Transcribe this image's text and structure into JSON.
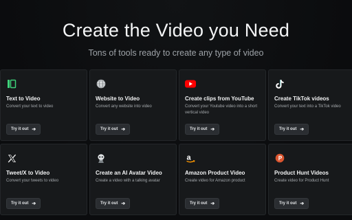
{
  "hero": {
    "title": "Create the Video you Need",
    "subtitle": "Tons of tools ready to create any type of video"
  },
  "cards": [
    {
      "title": "Text to Video",
      "description": "Convert your text to video",
      "button_label": "Try it out",
      "icon": "text-video-icon",
      "icon_color": "#3ed27a"
    },
    {
      "title": "Website to Video",
      "description": "Convert any website into video",
      "button_label": "Try it out",
      "icon": "globe-icon",
      "icon_color": "#cfd3d6"
    },
    {
      "title": "Create clips from YouTube",
      "description": "Convert your Youtube video into a short vertical video",
      "button_label": "Try it out",
      "icon": "youtube-icon",
      "icon_color": "#ff0000"
    },
    {
      "title": "Create TikTok videos",
      "description": "Convert your text into a TikTok video",
      "button_label": "Try it out",
      "icon": "tiktok-icon",
      "icon_color": "#ffffff"
    },
    {
      "title": "Tweet/X to Video",
      "description": "Convert your tweets to video",
      "button_label": "Try it out",
      "icon": "x-logo-icon",
      "icon_color": "#ffffff"
    },
    {
      "title": "Create an AI Avatar Video",
      "description": "Create a video with a talking avatar",
      "button_label": "Try it out",
      "icon": "avatar-icon",
      "icon_color": "#d9dcde"
    },
    {
      "title": "Amazon Product Video",
      "description": "Create video for Amazon product",
      "button_label": "Try it out",
      "icon": "amazon-icon",
      "icon_color": "#ff9900"
    },
    {
      "title": "Product Hunt Videos",
      "description": "Create video for Product Hunt",
      "button_label": "Try it out",
      "icon": "product-hunt-icon",
      "icon_color": "#da552f"
    }
  ]
}
